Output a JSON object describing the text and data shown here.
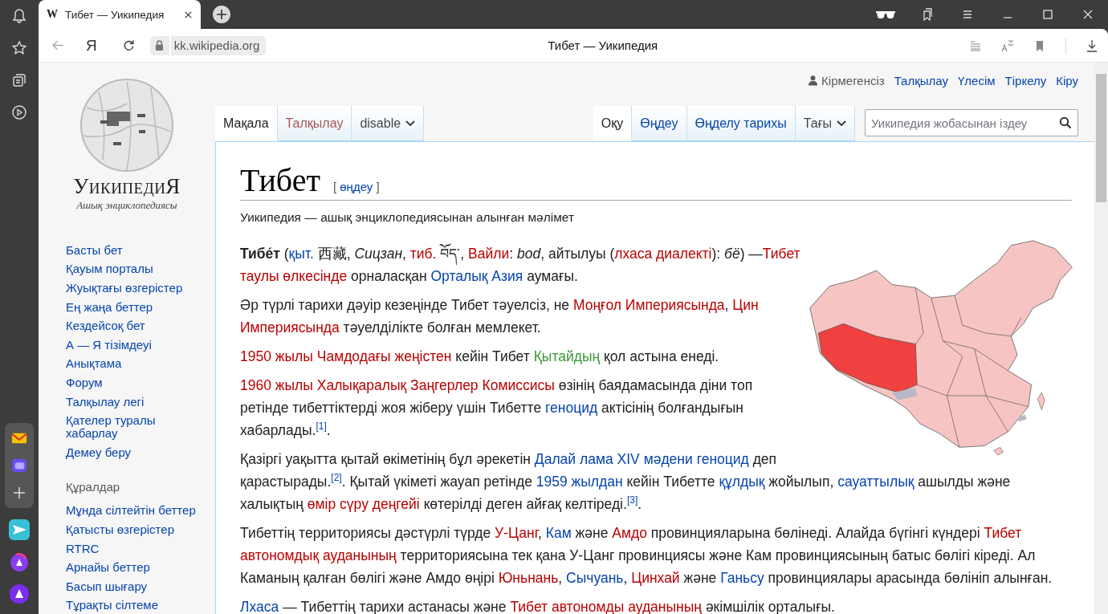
{
  "browser": {
    "tab": {
      "favicon": "W",
      "title": "Тибет — Уикипедия"
    },
    "logo": "Я",
    "url": "kk.wikipedia.org",
    "page_title": "Тибет — Уикипедия"
  },
  "wiki": {
    "logo": {
      "wordmark": "УикипедиЯ",
      "tagline": "Ашық энциклопедиясы"
    },
    "nav": [
      "Басты бет",
      "Қауым порталы",
      "Жуықтағы өзгерістер",
      "Ең жаңа беттер",
      "Кездейсоқ бет",
      "А — Я тізімдеуі",
      "Анықтама",
      "Форум",
      "Талқылау легі",
      "Қателер туралы хабарлау",
      "Демеу беру"
    ],
    "tools": {
      "heading": "Құралдар",
      "items": [
        "Мұнда сілтейтін беттер",
        "Қатысты өзгерістер",
        "RTRC",
        "Арнайы беттер",
        "Басып шығару",
        "Тұрақты сілтеме"
      ]
    },
    "personal": {
      "user": "Кірмегенсіз",
      "links": [
        "Талқылау",
        "Үлесім",
        "Тіркелу",
        "Кіру"
      ]
    },
    "tabs_left": [
      {
        "label": "Мақала",
        "selected": true,
        "kind": "tab"
      },
      {
        "label": "Талқылау",
        "selected": false,
        "kind": "new"
      },
      {
        "label": "disable",
        "selected": false,
        "kind": "menu"
      }
    ],
    "tabs_right": [
      {
        "label": "Оқу",
        "selected": true,
        "kind": "tab"
      },
      {
        "label": "Өңдеу",
        "selected": false,
        "kind": "tab"
      },
      {
        "label": "Өңделу тарихы",
        "selected": false,
        "kind": "tab"
      },
      {
        "label": "Тағы",
        "selected": false,
        "kind": "menu"
      }
    ],
    "search": {
      "placeholder": "Уикипедия жобасынан іздеу"
    },
    "title": "Тибет",
    "edit_section": {
      "open": "[",
      "link": "өңдеу",
      "close": "]"
    },
    "subtitle": "Уикипедия — ашық энциклопедиясынан алынған мәлімет",
    "paragraphs": [
      [
        {
          "text": "Тибе́т",
          "kind": "bold"
        },
        {
          "text": " (",
          "kind": "text"
        },
        {
          "text": "қыт.",
          "kind": "link"
        },
        {
          "text": " 西藏, ",
          "kind": "text"
        },
        {
          "text": "Сицзан",
          "kind": "italic"
        },
        {
          "text": ", ",
          "kind": "text"
        },
        {
          "text": "тиб.",
          "kind": "new"
        },
        {
          "text": " བོད་, ",
          "kind": "text"
        },
        {
          "text": "Вайли",
          "kind": "new"
        },
        {
          "text": ": ",
          "kind": "text"
        },
        {
          "text": "bod",
          "kind": "italic"
        },
        {
          "text": ", айтылуы (",
          "kind": "text"
        },
        {
          "text": "лхаса диалекті",
          "kind": "new"
        },
        {
          "text": "): ",
          "kind": "text"
        },
        {
          "text": "бё",
          "kind": "italic"
        },
        {
          "text": ") —",
          "kind": "text"
        },
        {
          "text": "Тибет",
          "kind": "new"
        },
        {
          "kind": "space"
        },
        {
          "text": "таулы өлкесінде",
          "kind": "new"
        },
        {
          "text": " орналасқан ",
          "kind": "text"
        },
        {
          "text": "Орталық Азия",
          "kind": "link"
        },
        {
          "text": " аумағы.",
          "kind": "text"
        }
      ],
      [
        {
          "text": "Әр түрлі тарихи дәуір кезеңінде Тибет тәуелсіз, не ",
          "kind": "text"
        },
        {
          "text": "Моңғол Империясында",
          "kind": "new"
        },
        {
          "text": ", ",
          "kind": "text"
        },
        {
          "text": "Цин",
          "kind": "new"
        },
        {
          "kind": "space"
        },
        {
          "text": "Империясында",
          "kind": "new"
        },
        {
          "text": " тәуелділікте болған мемлекет.",
          "kind": "text"
        }
      ],
      [
        {
          "text": "1950 жылы Чамдодағы жеңістен",
          "kind": "new"
        },
        {
          "text": " кейін Тибет ",
          "kind": "text"
        },
        {
          "text": "Қытайдың",
          "kind": "interwiki"
        },
        {
          "text": " қол астына енеді.",
          "kind": "text"
        }
      ],
      [
        {
          "text": "1960 жылы Халықаралық Заңгерлер Комиссисы",
          "kind": "new"
        },
        {
          "text": " өзінің баядамасында діни топ ретінде тибеттіктерді жоя жіберу үшін Тибетте ",
          "kind": "text"
        },
        {
          "text": "геноцид",
          "kind": "link"
        },
        {
          "text": " актісінің болғандығын хабарлады.",
          "kind": "text"
        },
        {
          "text": "[1]",
          "kind": "ref"
        },
        {
          "text": ".",
          "kind": "text"
        }
      ],
      [
        {
          "text": "Қазіргі уақытта қытай өкіметінің бұл әрекетін ",
          "kind": "text"
        },
        {
          "text": "Далай лама XIV",
          "kind": "link"
        },
        {
          "kind": "space"
        },
        {
          "text": "мәдени геноцид",
          "kind": "link"
        },
        {
          "text": " деп қарастырады.",
          "kind": "text"
        },
        {
          "text": "[2]",
          "kind": "ref"
        },
        {
          "text": ". Қытай үкіметі жауап ретінде ",
          "kind": "text"
        },
        {
          "text": "1959 жылдан",
          "kind": "link"
        },
        {
          "text": " кейін Тибетте ",
          "kind": "text"
        },
        {
          "text": "құлдық",
          "kind": "link"
        },
        {
          "text": " жойылып, ",
          "kind": "text"
        },
        {
          "text": "сауаттылық",
          "kind": "link"
        },
        {
          "text": " ашылды және халықтың ",
          "kind": "text"
        },
        {
          "text": "өмір сүру деңгейі",
          "kind": "new"
        },
        {
          "text": " көтерілді деген айғақ келтіреді.",
          "kind": "text"
        },
        {
          "text": "[3]",
          "kind": "ref"
        },
        {
          "text": ".",
          "kind": "text"
        }
      ],
      [
        {
          "text": "Тибеттің территориясы дәстүрлі түрде ",
          "kind": "text"
        },
        {
          "text": "У-Цанг",
          "kind": "new"
        },
        {
          "text": ", ",
          "kind": "text"
        },
        {
          "text": "Кам",
          "kind": "link"
        },
        {
          "text": " және ",
          "kind": "text"
        },
        {
          "text": "Амдо",
          "kind": "new"
        },
        {
          "text": " провинцияларына бөлінеді. Алайда бүгінгі күндері ",
          "kind": "text"
        },
        {
          "text": "Тибет",
          "kind": "new"
        },
        {
          "kind": "space"
        },
        {
          "text": "автономдық ауданының",
          "kind": "new"
        },
        {
          "text": " территориясына тек қана У-Цанг провинциясы және Кам провинциясының батыс бөлігі кіреді. Ал Каманың қалған бөлігі және Амдо өңірі ",
          "kind": "text"
        },
        {
          "text": "Юньнань",
          "kind": "new"
        },
        {
          "text": ", ",
          "kind": "text"
        },
        {
          "text": "Сычуань",
          "kind": "link"
        },
        {
          "text": ", ",
          "kind": "text"
        },
        {
          "text": "Цинхай",
          "kind": "new"
        },
        {
          "text": " және ",
          "kind": "text"
        },
        {
          "text": "Ганьсу",
          "kind": "link"
        },
        {
          "text": " провинциялары арасында бөлініп алынған.",
          "kind": "text"
        }
      ],
      [
        {
          "text": "Лхаса",
          "kind": "link"
        },
        {
          "text": " — Тибеттің тарихи астанасы және ",
          "kind": "text"
        },
        {
          "text": "Тибет автономды ауданының",
          "kind": "new"
        },
        {
          "text": " әкімшілік орталығы.",
          "kind": "text"
        }
      ]
    ]
  }
}
